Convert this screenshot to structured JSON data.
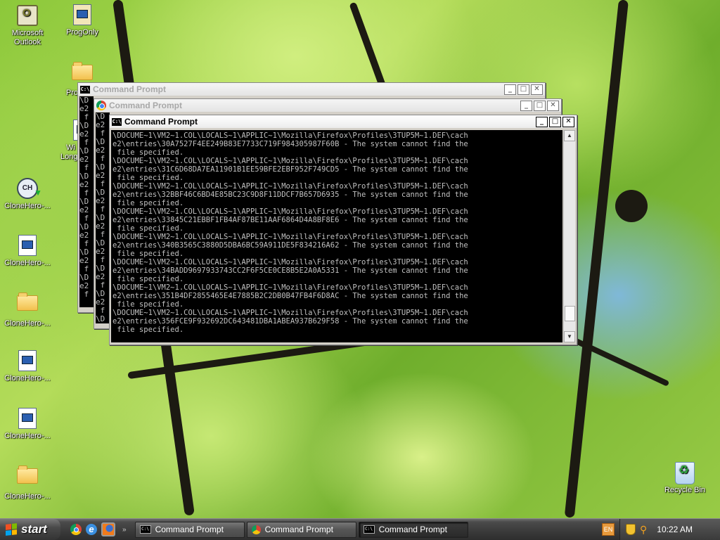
{
  "desktop": {
    "icons": [
      {
        "label": "Microsoft Outlook",
        "icon": "outlook-icon"
      },
      {
        "label": "ProgOnly",
        "icon": "folder-icon"
      },
      {
        "label": "Prog",
        "icon": "folder-icon"
      },
      {
        "label": "Wi",
        "icon": "document-icon"
      },
      {
        "label": "Long",
        "icon": "document-icon"
      },
      {
        "label": "CloneHero-...",
        "icon": "clonehero-shortcut-icon"
      },
      {
        "label": "CloneHero-...",
        "icon": "file-icon"
      },
      {
        "label": "CloneHero-...",
        "icon": "folder-icon"
      },
      {
        "label": "CloneHero-...",
        "icon": "file-icon"
      },
      {
        "label": "CloneHero-...",
        "icon": "file-icon"
      },
      {
        "label": "CloneHero-...",
        "icon": "folder-icon"
      },
      {
        "label": "Recycle Bin",
        "icon": "recycle-bin-icon"
      }
    ]
  },
  "windows": {
    "back": {
      "title": "Command Prompt",
      "console_text": "\\D\ne2\n f\n\\D\ne2\n f\n\\D\ne2\n f\n\\D\ne2\n f\n\\D\ne2\n f\n\\D\ne2\n f\n\\D\ne2\n f\n\\D\ne2\n f"
    },
    "middle": {
      "title": "Command Prompt",
      "console_text": "\\D\ne2\n f\n\\D\ne2\n f\n\\D\ne2\n f\n\\D\ne2\n f\n\\D\ne2\n f\n\\D\ne2\n f\n\\D\ne2\n f\n\\D\ne2\n f\n\\D"
    },
    "front": {
      "title": "Command Prompt",
      "console_text": "\\DOCUME~1\\VM2~1.COL\\LOCALS~1\\APPLIC~1\\Mozilla\\Firefox\\Profiles\\3TUP5M~1.DEF\\cach\ne2\\entries\\30A7527F4EE249B83E7733C719F984305987F60B - The system cannot find the\n file specified.\n\\DOCUME~1\\VM2~1.COL\\LOCALS~1\\APPLIC~1\\Mozilla\\Firefox\\Profiles\\3TUP5M~1.DEF\\cach\ne2\\entries\\31C6D68DA7EA11901B1EE59BFE2EBF952F749CD5 - The system cannot find the\n file specified.\n\\DOCUME~1\\VM2~1.COL\\LOCALS~1\\APPLIC~1\\Mozilla\\Firefox\\Profiles\\3TUP5M~1.DEF\\cach\ne2\\entries\\32BBF46C6BD4E85BC23C9D8F11DDCF7B657D6935 - The system cannot find the\n file specified.\n\\DOCUME~1\\VM2~1.COL\\LOCALS~1\\APPLIC~1\\Mozilla\\Firefox\\Profiles\\3TUP5M~1.DEF\\cach\ne2\\entries\\33845C21EBBF1FB4AF87BE11AAF6864D4A8BF8E6 - The system cannot find the\n file specified.\n\\DOCUME~1\\VM2~1.COL\\LOCALS~1\\APPLIC~1\\Mozilla\\Firefox\\Profiles\\3TUP5M~1.DEF\\cach\ne2\\entries\\340B3565C3880D5DBA6BC59A911DE5F834216A62 - The system cannot find the\n file specified.\n\\DOCUME~1\\VM2~1.COL\\LOCALS~1\\APPLIC~1\\Mozilla\\Firefox\\Profiles\\3TUP5M~1.DEF\\cach\ne2\\entries\\34BADD9697933743CC2F6F5CE0CE8B5E2A0A5331 - The system cannot find the\n file specified.\n\\DOCUME~1\\VM2~1.COL\\LOCALS~1\\APPLIC~1\\Mozilla\\Firefox\\Profiles\\3TUP5M~1.DEF\\cach\ne2\\entries\\351B4DF2855465E4E7885B2C2DB0B47FB4F6D8AC - The system cannot find the\n file specified.\n\\DOCUME~1\\VM2~1.COL\\LOCALS~1\\APPLIC~1\\Mozilla\\Firefox\\Profiles\\3TUP5M~1.DEF\\cach\ne2\\entries\\356FCE9F932692DC643481DBA1ABEA937B629F58 - The system cannot find the\n file specified."
    }
  },
  "taskbar": {
    "start_label": "start",
    "quick_launch": [
      "chrome-icon",
      "internet-explorer-icon",
      "firefox-icon"
    ],
    "tasks": [
      {
        "label": "Command Prompt",
        "icon": "cmd-icon"
      },
      {
        "label": "Command Prompt",
        "icon": "chrome-icon"
      },
      {
        "label": "Command Prompt",
        "icon": "cmd-icon"
      }
    ],
    "tray": {
      "lang": "EN",
      "clock": "10:22 AM"
    }
  }
}
